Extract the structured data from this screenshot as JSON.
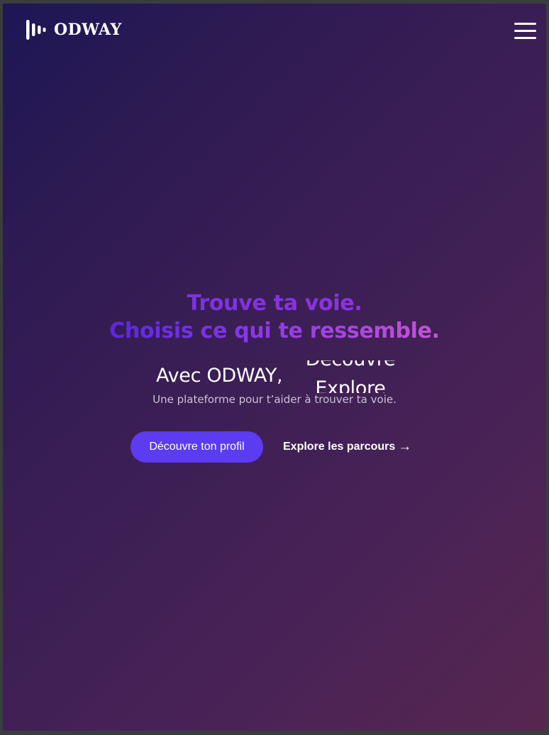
{
  "brand": {
    "name": "ODWAY"
  },
  "header": {
    "menu_icon": "hamburger-menu-icon"
  },
  "hero": {
    "line1": "Trouve ta voie.",
    "line2": "Choisis ce qui te ressemble.",
    "prefix": "Avec ODWAY,",
    "rotating_words": [
      "Découvre",
      "Explore"
    ],
    "subtitle": "Une plateforme pour t’aider à trouver ta voie."
  },
  "cta": {
    "primary_label": "Découvre ton profil",
    "secondary_label": "Explore les parcours",
    "secondary_arrow": "→"
  },
  "colors": {
    "background_start": "#1d1656",
    "background_end": "#57264f",
    "primary_button": "#5b3cf0",
    "gradient_text_start": "#4b19c6",
    "gradient_text_end": "#ee7ac8"
  }
}
